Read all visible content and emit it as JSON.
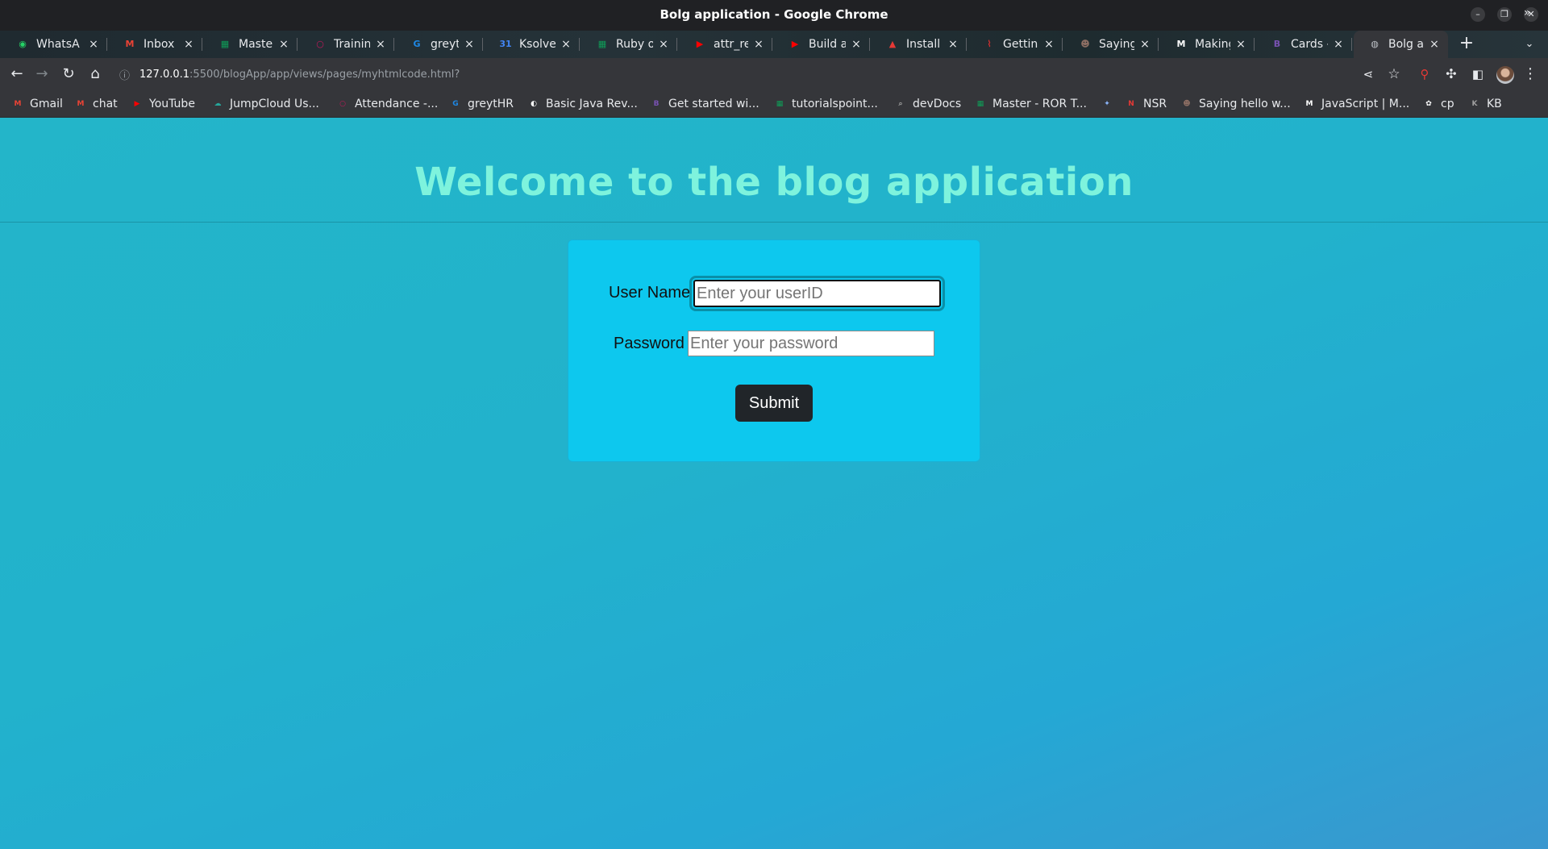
{
  "window": {
    "title": "Bolg application - Google Chrome",
    "controls": [
      "minimize",
      "restore",
      "close"
    ]
  },
  "tabs": [
    {
      "label": "WhatsA",
      "icon": "whatsapp-icon",
      "color": "#25d366"
    },
    {
      "label": "Inbox - J",
      "icon": "gmail-icon",
      "color": "#ea4335"
    },
    {
      "label": "Master -",
      "icon": "sheets-icon",
      "color": "#0f9d58"
    },
    {
      "label": "Training",
      "icon": "circle-icon",
      "color": "#c2185b"
    },
    {
      "label": "greytHR",
      "icon": "greythr-icon",
      "color": "#1e88e5"
    },
    {
      "label": "Ksolves",
      "icon": "calendar-icon",
      "color": "#4285f4"
    },
    {
      "label": "Ruby on",
      "icon": "sheets-icon",
      "color": "#0f9d58"
    },
    {
      "label": "attr_rea",
      "icon": "youtube-icon",
      "color": "#ff0000"
    },
    {
      "label": "Build a",
      "icon": "youtube-icon",
      "color": "#ff0000"
    },
    {
      "label": "Install R",
      "icon": "warning-icon",
      "color": "#e53935"
    },
    {
      "label": "Getting",
      "icon": "rails-icon",
      "color": "#d32f2f"
    },
    {
      "label": "Saying h",
      "icon": "cat-icon",
      "color": "#8d6e63"
    },
    {
      "label": "Making",
      "icon": "mdn-icon",
      "color": "#ffffff"
    },
    {
      "label": "Cards - B",
      "icon": "bootstrap-icon",
      "color": "#7952b3"
    },
    {
      "label": "Bolg ap",
      "icon": "globe-icon",
      "color": "#bdc1c6",
      "active": true
    }
  ],
  "toolbar": {
    "url_host": "127.0.0.1",
    "url_path": ":5500/blogApp/app/views/pages/myhtmlcode.html?"
  },
  "bookmarks": [
    {
      "label": "Gmail",
      "icon": "gmail-icon",
      "color": "#ea4335"
    },
    {
      "label": "chat",
      "icon": "gmail-icon",
      "color": "#ea4335"
    },
    {
      "label": "YouTube",
      "icon": "youtube-icon",
      "color": "#ff0000"
    },
    {
      "label": "JumpCloud Us...",
      "icon": "jumpcloud-icon",
      "color": "#26a69a"
    },
    {
      "label": "Attendance -...",
      "icon": "circle-icon",
      "color": "#c2185b"
    },
    {
      "label": "greytHR",
      "icon": "greythr-icon",
      "color": "#1e88e5"
    },
    {
      "label": "Basic Java Rev...",
      "icon": "github-icon",
      "color": "#ffffff"
    },
    {
      "label": "Get started wi...",
      "icon": "bootstrap-icon",
      "color": "#7952b3"
    },
    {
      "label": "tutorialspoint...",
      "icon": "sheets-icon",
      "color": "#0f9d58"
    },
    {
      "label": "devDocs",
      "icon": "search-doc-icon",
      "color": "#9e9e9e"
    },
    {
      "label": "Master - ROR T...",
      "icon": "sheets-icon",
      "color": "#0f9d58"
    },
    {
      "label": "",
      "icon": "sparkle-icon",
      "color": "#8ab4f8"
    },
    {
      "label": "NSR",
      "icon": "nsr-icon",
      "color": "#e53935"
    },
    {
      "label": "Saying hello w...",
      "icon": "cat-icon",
      "color": "#8d6e63"
    },
    {
      "label": "JavaScript | M...",
      "icon": "mdn-icon",
      "color": "#ffffff"
    },
    {
      "label": "cp",
      "icon": "chatgpt-icon",
      "color": "#ffffff"
    },
    {
      "label": "KB",
      "icon": "kb-icon",
      "color": "#9e9e9e"
    }
  ],
  "page": {
    "heading": "Welcome to the blog application",
    "form": {
      "username_label": "User Name",
      "username_placeholder": "Enter your userID",
      "password_label": "Password",
      "password_placeholder": "Enter your password",
      "submit_label": "Submit"
    }
  }
}
